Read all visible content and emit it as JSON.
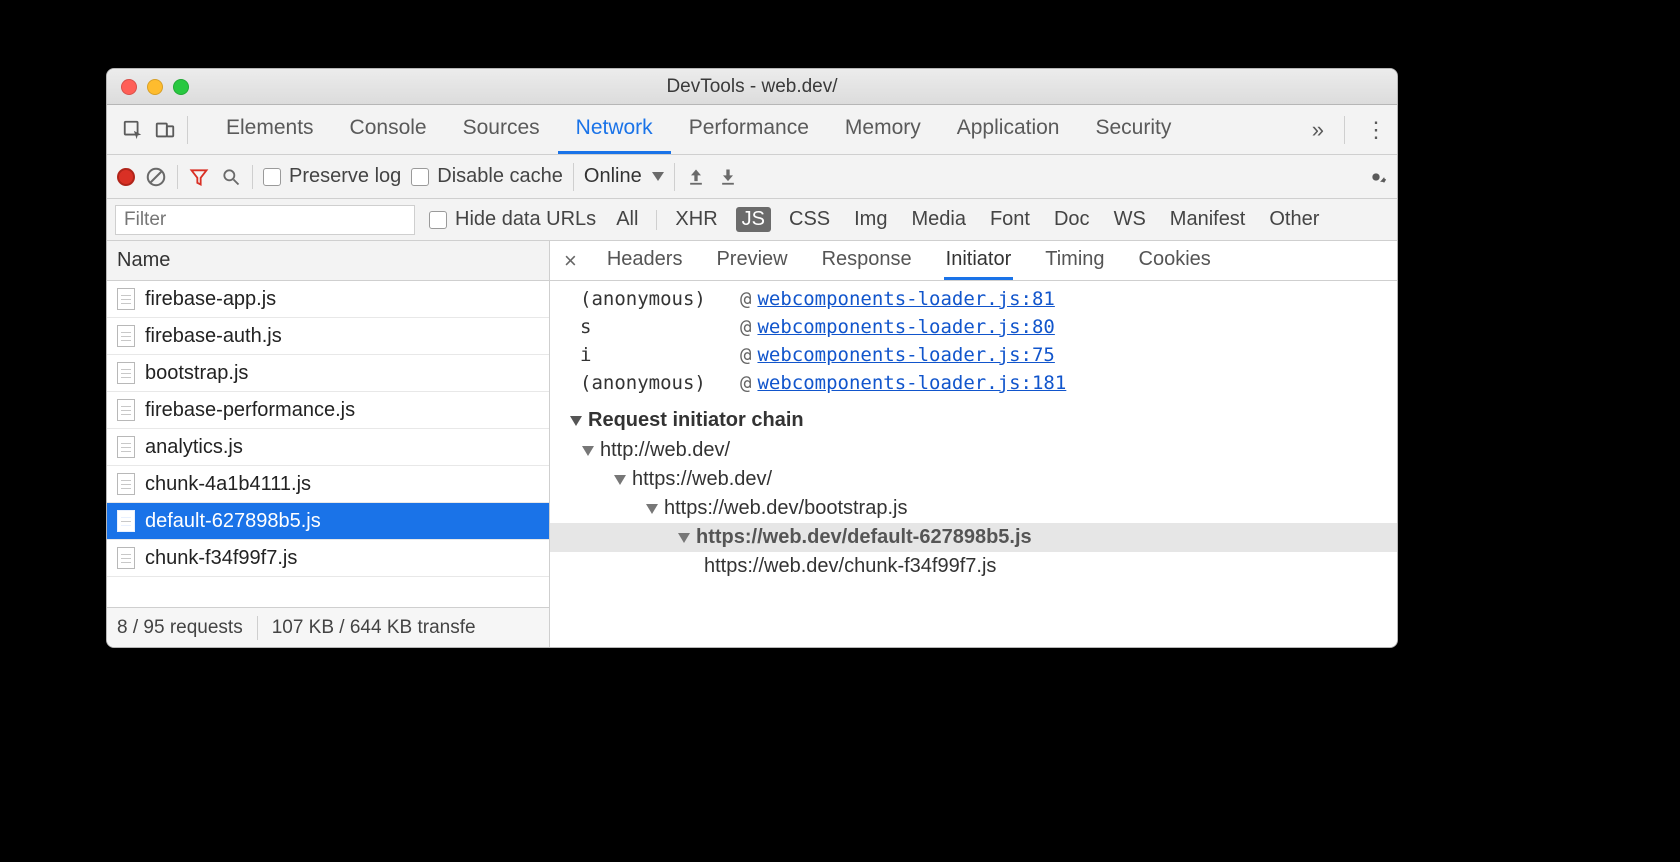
{
  "window": {
    "title": "DevTools - web.dev/"
  },
  "main_tabs": [
    "Elements",
    "Console",
    "Sources",
    "Network",
    "Performance",
    "Memory",
    "Application",
    "Security"
  ],
  "main_tabs_active_index": 3,
  "net_toolbar": {
    "preserve_log": "Preserve log",
    "disable_cache": "Disable cache",
    "throttling": "Online"
  },
  "filter": {
    "placeholder": "Filter",
    "hide_data_urls": "Hide data URLs",
    "types": [
      "All",
      "XHR",
      "JS",
      "CSS",
      "Img",
      "Media",
      "Font",
      "Doc",
      "WS",
      "Manifest",
      "Other"
    ],
    "types_selected_index": 2
  },
  "left": {
    "header": "Name",
    "requests": [
      "firebase-app.js",
      "firebase-auth.js",
      "bootstrap.js",
      "firebase-performance.js",
      "analytics.js",
      "chunk-4a1b4111.js",
      "default-627898b5.js",
      "chunk-f34f99f7.js"
    ],
    "selected_index": 6,
    "status": {
      "requests": "8 / 95 requests",
      "transfer": "107 KB / 644 KB transfe"
    }
  },
  "detail_tabs": [
    "Headers",
    "Preview",
    "Response",
    "Initiator",
    "Timing",
    "Cookies"
  ],
  "detail_tabs_active_index": 3,
  "stack": [
    {
      "fn": "(anonymous)",
      "link": "webcomponents-loader.js:81"
    },
    {
      "fn": "s",
      "link": "webcomponents-loader.js:80"
    },
    {
      "fn": "i",
      "link": "webcomponents-loader.js:75"
    },
    {
      "fn": "(anonymous)",
      "link": "webcomponents-loader.js:181"
    }
  ],
  "chain_header": "Request initiator chain",
  "chain": [
    {
      "indent": 0,
      "url": "http://web.dev/",
      "disclose": true,
      "current": false
    },
    {
      "indent": 1,
      "url": "https://web.dev/",
      "disclose": true,
      "current": false
    },
    {
      "indent": 2,
      "url": "https://web.dev/bootstrap.js",
      "disclose": true,
      "current": false
    },
    {
      "indent": 3,
      "url": "https://web.dev/default-627898b5.js",
      "disclose": true,
      "current": true
    },
    {
      "indent": 4,
      "url": "https://web.dev/chunk-f34f99f7.js",
      "disclose": false,
      "current": false
    }
  ]
}
